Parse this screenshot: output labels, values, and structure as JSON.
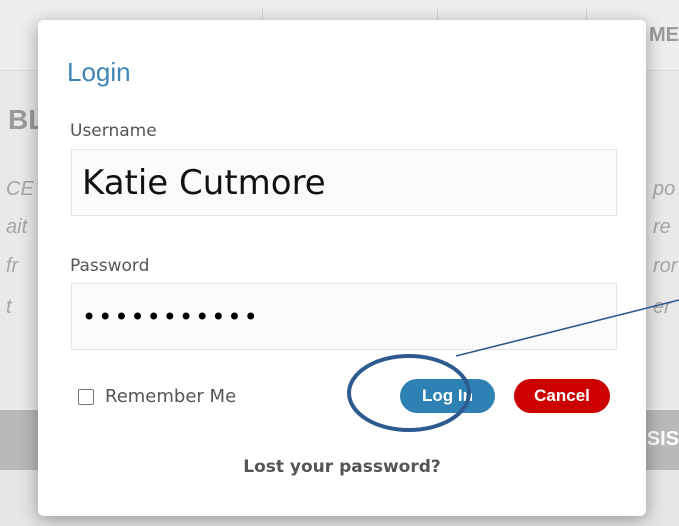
{
  "background": {
    "topbar_label": "ME",
    "heading_left": "BL",
    "left_text": [
      "CE",
      "ait",
      "fr",
      "t"
    ],
    "right_text": [
      "po",
      "re",
      "ror",
      "er"
    ],
    "band_label": "SIS"
  },
  "modal": {
    "title": "Login",
    "username": {
      "label": "Username",
      "value": "Katie Cutmore"
    },
    "password": {
      "label": "Password",
      "value": "•••••••••••"
    },
    "remember_label": "Remember Me",
    "remember_checked": false,
    "login_button": "Log In",
    "cancel_button": "Cancel",
    "lost_password_link": "Lost your password?"
  },
  "colors": {
    "title": "#3d86b5",
    "login_button": "#2e82b3",
    "cancel_button": "#cc0000",
    "annotation": "#2d5b8f"
  }
}
